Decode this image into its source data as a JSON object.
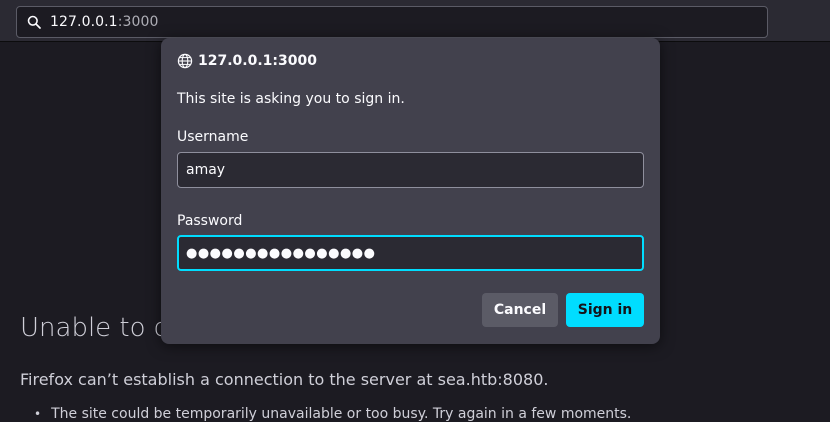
{
  "browser": {
    "url": {
      "host": "127.0.0.1",
      "port": ":3000",
      "icon": "search-icon"
    }
  },
  "error_page": {
    "title": "Unable to co",
    "description": "Firefox can’t establish a connection to the server at sea.htb:8080.",
    "bullets": [
      "The site could be temporarily unavailable or too busy. Try again in a few moments."
    ]
  },
  "auth_dialog": {
    "origin": "127.0.0.1:3000",
    "origin_icon": "globe-icon",
    "message": "This site is asking you to sign in.",
    "username_label": "Username",
    "username_value": "amay",
    "password_label": "Password",
    "password_mask": "●●●●●●●●●●●●●●●●",
    "cancel_label": "Cancel",
    "signin_label": "Sign in"
  },
  "colors": {
    "accent": "#00ddff",
    "dialog_bg": "#42414d",
    "page_bg": "#1c1b22"
  }
}
